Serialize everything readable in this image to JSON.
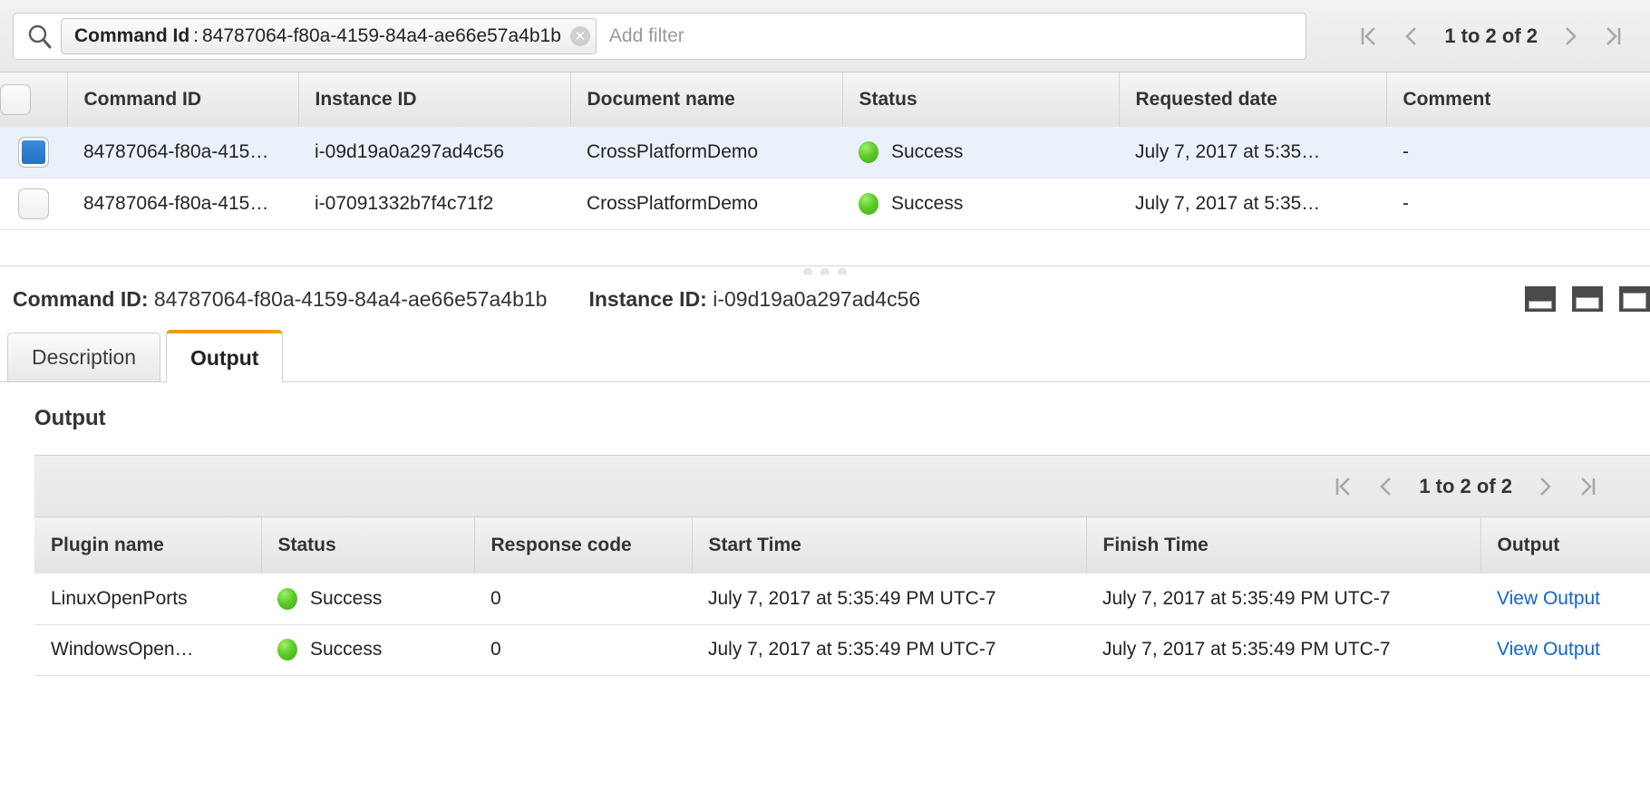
{
  "filter_bar": {
    "search_icon": "search-icon",
    "token": {
      "key": "Command Id",
      "separator": ":",
      "value": "84787064-f80a-4159-84a4-ae66e57a4b1b",
      "remove_icon": "✕"
    },
    "placeholder": "Add filter",
    "pager": {
      "first_icon": "|<",
      "prev_icon": "<",
      "label": "1 to 2 of 2",
      "next_icon": ">",
      "last_icon": ">|"
    }
  },
  "commands_table": {
    "columns": [
      "Command ID",
      "Instance ID",
      "Document name",
      "Status",
      "Requested date",
      "Comment"
    ],
    "rows": [
      {
        "selected": true,
        "command_id": "84787064-f80a-415…",
        "instance_id": "i-09d19a0a297ad4c56",
        "document_name": "CrossPlatformDemo",
        "status": "Success",
        "requested_date": "July 7, 2017 at 5:35…",
        "comment": "-"
      },
      {
        "selected": false,
        "command_id": "84787064-f80a-415…",
        "instance_id": "i-07091332b7f4c71f2",
        "document_name": "CrossPlatformDemo",
        "status": "Success",
        "requested_date": "July 7, 2017 at 5:35…",
        "comment": "-"
      }
    ]
  },
  "detail": {
    "command_id_label": "Command ID:",
    "command_id_value": "84787064-f80a-4159-84a4-ae66e57a4b1b",
    "instance_id_label": "Instance ID:",
    "instance_id_value": "i-09d19a0a297ad4c56",
    "panel_icons": [
      "panel-size-small-icon",
      "panel-size-medium-icon",
      "panel-size-large-icon"
    ],
    "tabs": [
      {
        "label": "Description",
        "active": false
      },
      {
        "label": "Output",
        "active": true
      }
    ],
    "accent_color": "#ef9a18"
  },
  "output_section": {
    "title": "Output",
    "pager": {
      "first_icon": "|<",
      "prev_icon": "<",
      "label": "1 to 2 of 2",
      "next_icon": ">",
      "last_icon": ">|"
    },
    "columns": [
      "Plugin name",
      "Status",
      "Response code",
      "Start Time",
      "Finish Time",
      "Output"
    ],
    "rows": [
      {
        "plugin_name": "LinuxOpenPorts",
        "status": "Success",
        "response_code": "0",
        "start_time": "July 7, 2017 at 5:35:49 PM UTC-7",
        "finish_time": "July 7, 2017 at 5:35:49 PM UTC-7",
        "output_link": "View Output"
      },
      {
        "plugin_name": "WindowsOpen…",
        "status": "Success",
        "response_code": "0",
        "start_time": "July 7, 2017 at 5:35:49 PM UTC-7",
        "finish_time": "July 7, 2017 at 5:35:49 PM UTC-7",
        "output_link": "View Output"
      }
    ]
  },
  "colors": {
    "status_green": "#5ecb2a",
    "link_blue": "#1166cc",
    "selected_row": "#eaf1fb",
    "checkbox_blue": "#2a7fd4"
  }
}
